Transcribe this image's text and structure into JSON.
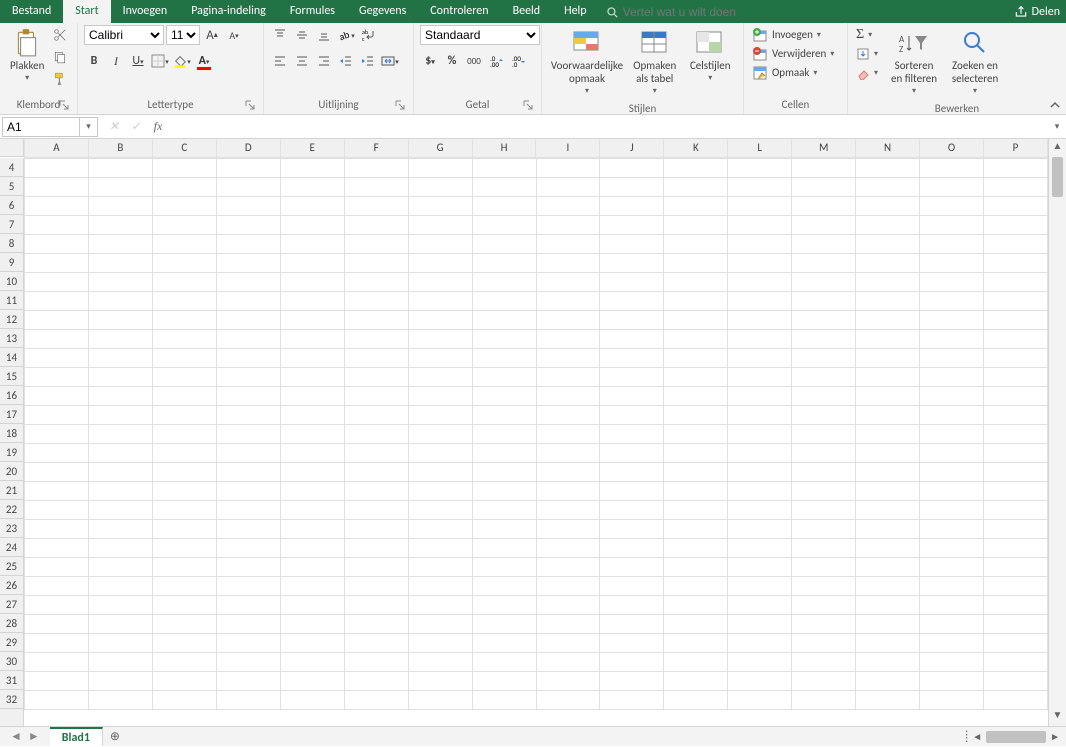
{
  "tabs": {
    "bestand": "Bestand",
    "start": "Start",
    "invoegen": "Invoegen",
    "pagina": "Pagina-indeling",
    "formules": "Formules",
    "gegevens": "Gegevens",
    "controleren": "Controleren",
    "beeld": "Beeld",
    "help": "Help"
  },
  "tellme_placeholder": "Vertel wat u wilt doen",
  "share": "Delen",
  "groups": {
    "klembord": "Klembord",
    "lettertype": "Lettertype",
    "uitlijning": "Uitlijning",
    "getal": "Getal",
    "stijlen": "Stijlen",
    "cellen": "Cellen",
    "bewerken": "Bewerken"
  },
  "clipboard": {
    "paste": "Plakken"
  },
  "font": {
    "name": "Calibri",
    "size": "11"
  },
  "number": {
    "format": "Standaard"
  },
  "styles": {
    "conditional": "Voorwaardelijke opmaak",
    "astable": "Opmaken als tabel",
    "cellstyles": "Celstijlen"
  },
  "cells": {
    "insert": "Invoegen",
    "delete": "Verwijderen",
    "format": "Opmaak"
  },
  "editing": {
    "sort": "Sorteren en filteren",
    "find": "Zoeken en selecteren"
  },
  "namebox": "A1",
  "formula": "",
  "columns": [
    "A",
    "B",
    "C",
    "D",
    "E",
    "F",
    "G",
    "H",
    "I",
    "J",
    "K",
    "L",
    "M",
    "N",
    "O",
    "P"
  ],
  "row_start": 4,
  "row_end": 32,
  "sheet_tab": "Blad1"
}
